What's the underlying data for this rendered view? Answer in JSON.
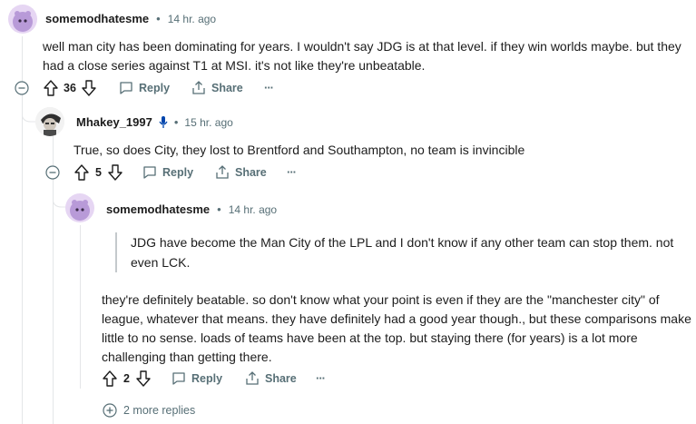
{
  "colors": {
    "avatar_purple": "#b89ad8",
    "muted": "#576f76",
    "line": "#e4e6e8"
  },
  "comment1": {
    "username": "somemodhatesme",
    "time": "14 hr. ago",
    "body_line1": "well man city has been dominating for years. I wouldn't say JDG is at that level. if they win worlds maybe. but they",
    "body_line2": "had a close series against T1 at MSI. it's not like they're unbeatable.",
    "votes": "36",
    "reply_label": "Reply",
    "share_label": "Share",
    "more_label": "···"
  },
  "comment2": {
    "username": "Mhakey_1997",
    "time": "15 hr. ago",
    "body": "True, so does City, they lost to Brentford and Southampton, no team is invincible",
    "votes": "5",
    "reply_label": "Reply",
    "share_label": "Share",
    "more_label": "···"
  },
  "comment3": {
    "username": "somemodhatesme",
    "time": "14 hr. ago",
    "quote_line1": "JDG have become the Man City of the LPL and I don't know if any other team can stop them. not",
    "quote_line2": "even LCK.",
    "body_line1": "they're definitely beatable. so don't know what your point is even if they are the \"manchester city\" of",
    "body_line2": "league, whatever that means. they have definitely had a good year though., but these comparisons make",
    "body_line3": "little to no sense. loads of teams have been at the top. but staying there (for years) is a lot more",
    "body_line4": "challenging than getting there.",
    "votes": "2",
    "reply_label": "Reply",
    "share_label": "Share",
    "more_label": "···"
  },
  "more_replies": "2 more replies",
  "separator": "•"
}
